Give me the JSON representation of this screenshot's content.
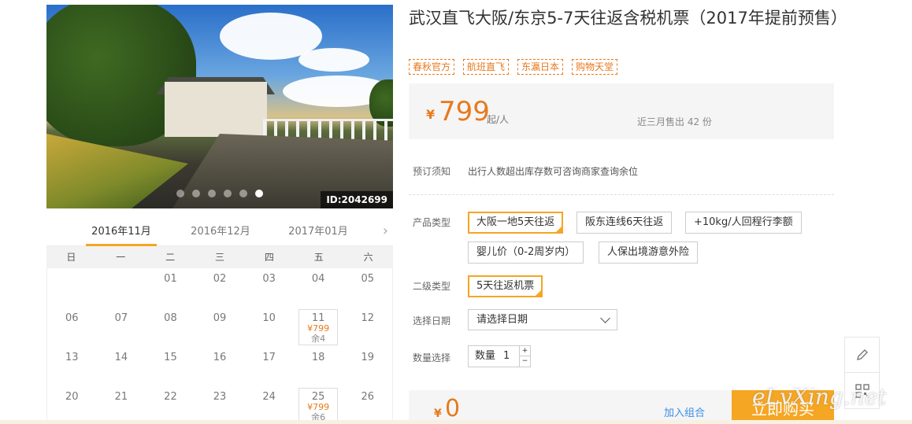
{
  "product": {
    "title": "武汉直飞大阪/东京5-7天往返含税机票（2017年提前预售）",
    "tags": [
      "春秋官方",
      "航班直飞",
      "东瀛日本",
      "购物天堂"
    ],
    "photo_id": "ID:2042699",
    "photo_dot_count": 6,
    "photo_active_dot": 5
  },
  "price": {
    "currency": "¥",
    "amount": "799",
    "unit": "起/人",
    "sold": "近三月售出 42 份"
  },
  "notice": {
    "label": "预订须知",
    "text": "出行人数超出库存数可咨询商家查询余位"
  },
  "product_type": {
    "label": "产品类型",
    "options": [
      "大阪一地5天往返",
      "阪东连线6天往返",
      "+10kg/人回程行李额",
      "婴儿价（0-2周岁内）",
      "人保出境游意外险"
    ],
    "selected": 0
  },
  "sub_type": {
    "label": "二级类型",
    "options": [
      "5天往返机票"
    ],
    "selected": 0
  },
  "date": {
    "label": "选择日期",
    "placeholder": "请选择日期"
  },
  "quantity": {
    "label": "数量选择",
    "prefix": "数量",
    "value": "1",
    "plus": "+",
    "minus": "−"
  },
  "footer": {
    "currency": "¥",
    "total": "0",
    "combo": "加入组合",
    "buy": "立即购买"
  },
  "watermark": "eLvXing.net",
  "calendar": {
    "tabs": [
      "2016年11月",
      "2016年12月",
      "2017年01月"
    ],
    "active_tab": 0,
    "next": "›",
    "weekdays": [
      "日",
      "一",
      "二",
      "三",
      "四",
      "五",
      "六"
    ],
    "weeks": [
      [
        {
          "d": ""
        },
        {
          "d": ""
        },
        {
          "d": "01"
        },
        {
          "d": "02"
        },
        {
          "d": "03"
        },
        {
          "d": "04"
        },
        {
          "d": "05"
        }
      ],
      [
        {
          "d": "06"
        },
        {
          "d": "07"
        },
        {
          "d": "08"
        },
        {
          "d": "09"
        },
        {
          "d": "10"
        },
        {
          "d": "11",
          "price": "¥799",
          "remain": "余4"
        },
        {
          "d": "12"
        }
      ],
      [
        {
          "d": "13"
        },
        {
          "d": "14"
        },
        {
          "d": "15"
        },
        {
          "d": "16"
        },
        {
          "d": "17"
        },
        {
          "d": "18"
        },
        {
          "d": "19"
        }
      ],
      [
        {
          "d": "20"
        },
        {
          "d": "21"
        },
        {
          "d": "22"
        },
        {
          "d": "23"
        },
        {
          "d": "24"
        },
        {
          "d": "25",
          "price": "¥799",
          "remain": "余6"
        },
        {
          "d": "26"
        }
      ]
    ]
  }
}
